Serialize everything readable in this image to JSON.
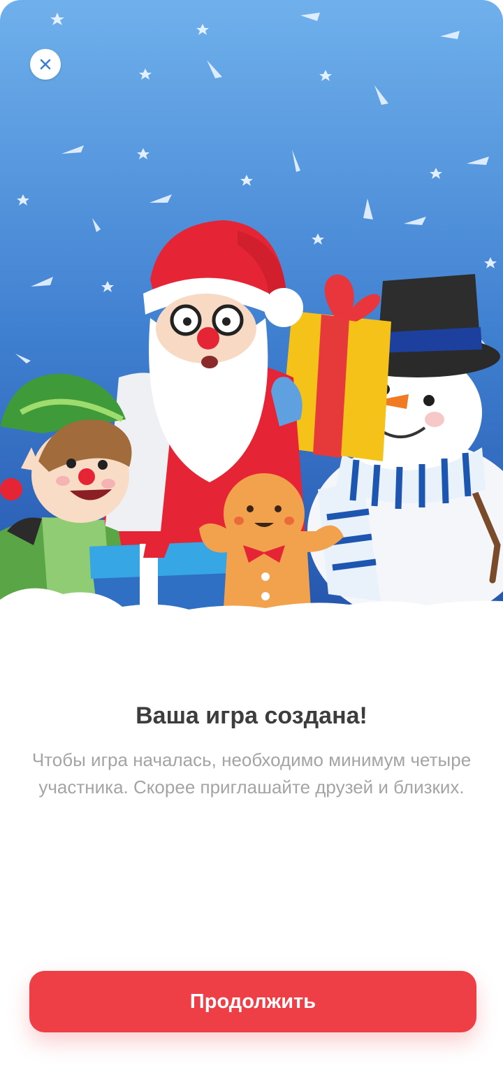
{
  "header": {
    "close_icon": "close-icon"
  },
  "illustration": {
    "subjects": [
      "santa-claus",
      "elf",
      "gingerbread-man",
      "snowman",
      "gift-boxes",
      "snowflakes"
    ],
    "colors": {
      "sky_top": "#6aaae8",
      "sky_bottom": "#2a5fb6",
      "santa_red": "#e52535",
      "snow": "#ffffff"
    }
  },
  "content": {
    "title": "Ваша игра создана!",
    "description": "Чтобы игра началась, необходимо минимум четыре участника. Скорее приглашайте друзей и близких."
  },
  "actions": {
    "continue_label": "Продолжить"
  },
  "colors": {
    "accent": "#ee3e46",
    "title": "#3d3d3d",
    "text_muted": "#a4a4a4"
  }
}
